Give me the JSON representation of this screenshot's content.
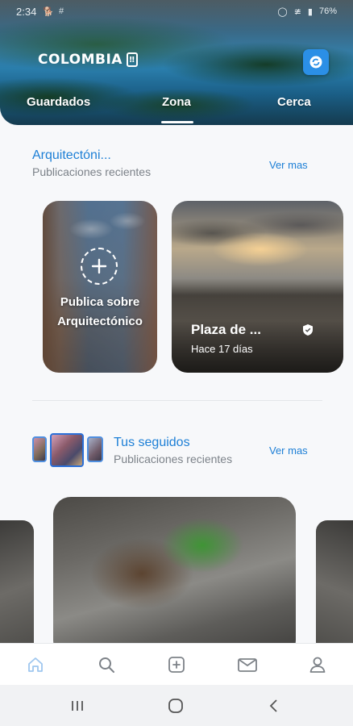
{
  "status_bar": {
    "time": "2:34",
    "battery": "76%"
  },
  "header": {
    "logo_text": "COLOMBIA",
    "tabs": [
      {
        "label": "Guardados"
      },
      {
        "label": "Zona",
        "active": true
      },
      {
        "label": "Cerca"
      }
    ]
  },
  "section_arch": {
    "title": "Arquitectóni...",
    "subtitle": "Publicaciones recientes",
    "see_more": "Ver mas",
    "create_card": {
      "label_line1": "Publica sobre",
      "label_line2": "Arquitectónico"
    },
    "post_card": {
      "title": "Plaza de ...",
      "time": "Hace 17 días"
    }
  },
  "section_following": {
    "title": "Tus seguidos",
    "subtitle": "Publicaciones recientes",
    "see_more": "Ver mas"
  },
  "bottom_nav": {
    "items": [
      {
        "icon": "home-icon",
        "active": true
      },
      {
        "icon": "search-icon"
      },
      {
        "icon": "add-post-icon"
      },
      {
        "icon": "mail-icon"
      },
      {
        "icon": "profile-icon"
      }
    ]
  },
  "colors": {
    "accent": "#1d7fd6",
    "muted_text": "#7c8289",
    "active_nav": "#9fc7ef",
    "inactive_nav": "#7d8288"
  }
}
